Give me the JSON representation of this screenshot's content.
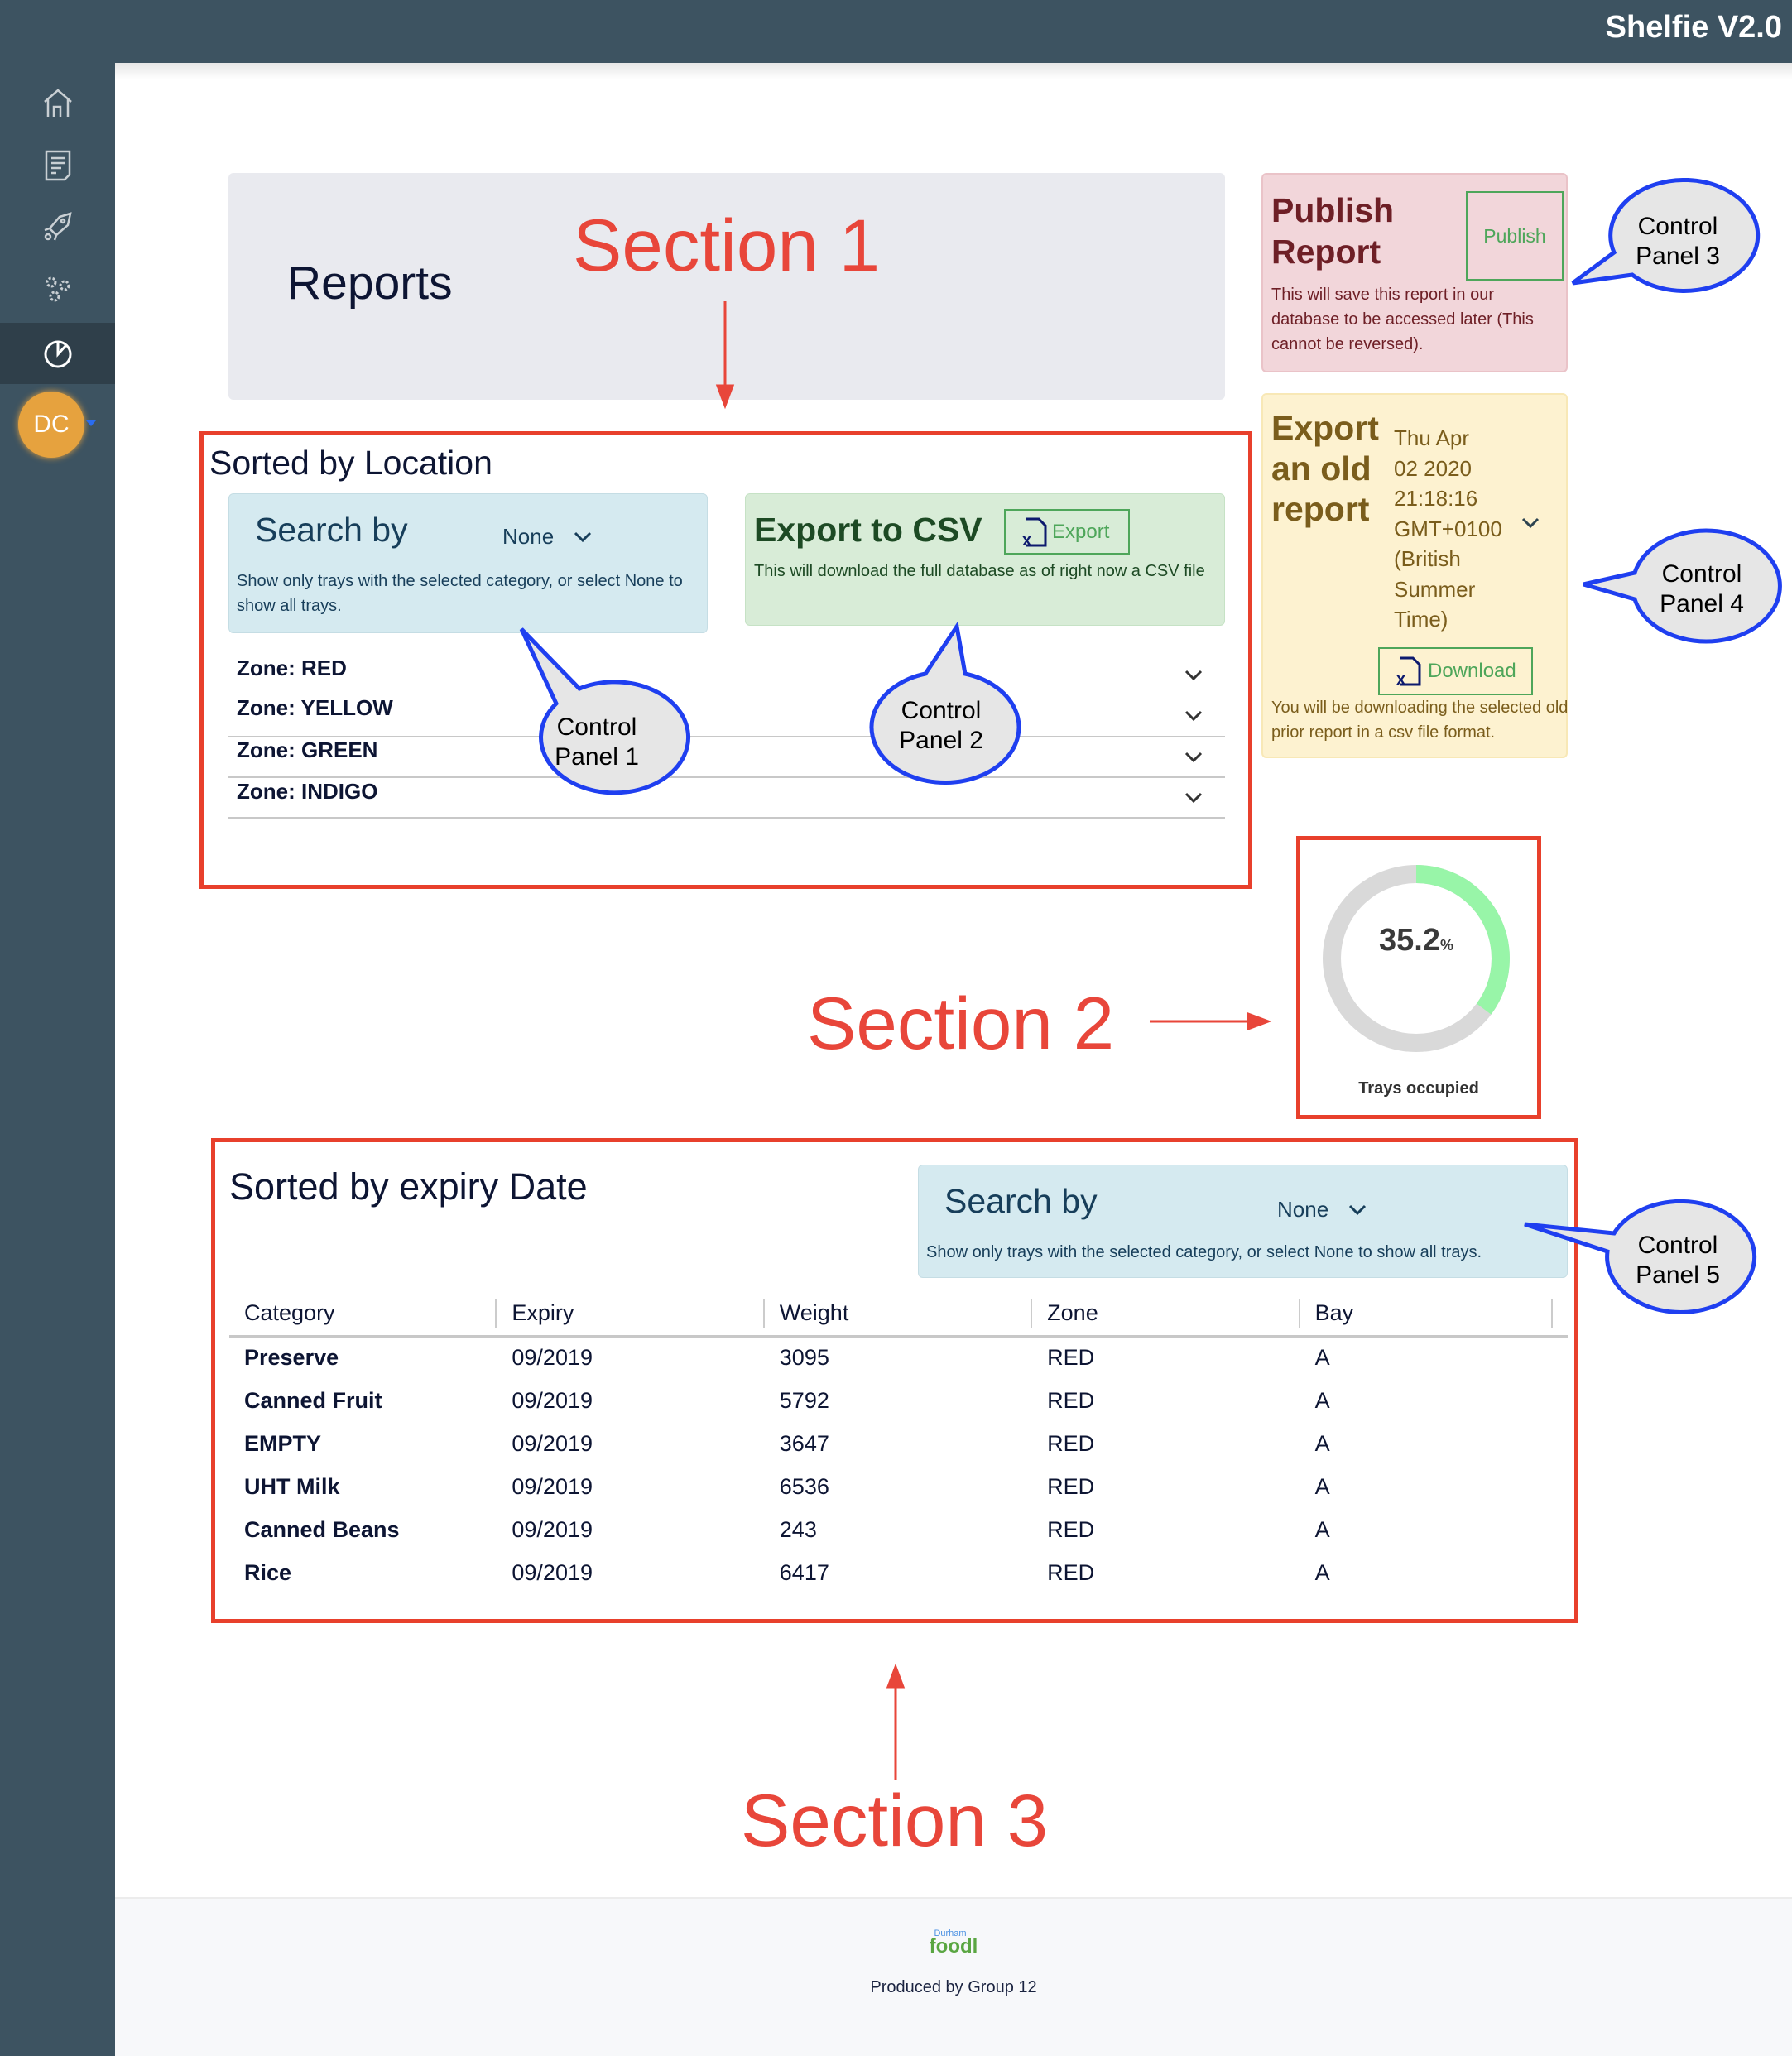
{
  "app": {
    "title": "Shelfie V2.0",
    "avatar_initials": "DC"
  },
  "sidebar": {
    "items": [
      {
        "icon": "menu-icon"
      },
      {
        "icon": "home-icon"
      },
      {
        "icon": "document-icon"
      },
      {
        "icon": "rocket-icon"
      },
      {
        "icon": "gears-icon"
      },
      {
        "icon": "pie-chart-icon",
        "active": true
      }
    ]
  },
  "header": {
    "title": "Reports"
  },
  "annotations": {
    "section1": "Section 1",
    "section2": "Section 2",
    "section3": "Section 3",
    "cp1": [
      "Control",
      "Panel 1"
    ],
    "cp2": [
      "Control",
      "Panel 2"
    ],
    "cp3": [
      "Control",
      "Panel 3"
    ],
    "cp4": [
      "Control",
      "Panel 4"
    ],
    "cp5": [
      "Control",
      "Panel 5"
    ]
  },
  "location": {
    "title": "Sorted by Location",
    "search": {
      "label": "Search by",
      "selected": "None",
      "help": "Show only trays with the selected category, or select None to show all trays."
    },
    "export": {
      "title": "Export to CSV",
      "button": "Export",
      "help": "This will download the full database as of right now a CSV file"
    },
    "zones": [
      "Zone: RED",
      "Zone: YELLOW",
      "Zone: GREEN",
      "Zone: INDIGO"
    ]
  },
  "publish": {
    "title_line1": "Publish",
    "title_line2": "Report",
    "button": "Publish",
    "help": "This will save this report in our database to be accessed later (This cannot be reversed)."
  },
  "export_old": {
    "title_lines": [
      "Export",
      "an old",
      "report"
    ],
    "selected_lines": [
      "Thu Apr",
      "02 2020",
      "21:18:16",
      "GMT+0100",
      "(British",
      "Summer",
      "Time)"
    ],
    "button": "Download",
    "help": "You will be downloading the selected old prior report in a csv file format."
  },
  "occupancy": {
    "value": "35.2",
    "unit": "%",
    "fraction": 0.352,
    "label": "Trays occupied",
    "colors": {
      "fill": "#98f5a8",
      "track": "#d9d9d9"
    }
  },
  "expiry": {
    "title": "Sorted by expiry Date",
    "search": {
      "label": "Search by",
      "selected": "None",
      "help": "Show only trays with the selected category, or select None to show all trays."
    },
    "columns": [
      "Category",
      "Expiry",
      "Weight",
      "Zone",
      "Bay"
    ],
    "rows": [
      [
        "Preserve",
        "09/2019",
        "3095",
        "RED",
        "A"
      ],
      [
        "Canned Fruit",
        "09/2019",
        "5792",
        "RED",
        "A"
      ],
      [
        "EMPTY",
        "09/2019",
        "3647",
        "RED",
        "A"
      ],
      [
        "UHT Milk",
        "09/2019",
        "6536",
        "RED",
        "A"
      ],
      [
        "Canned Beans",
        "09/2019",
        "243",
        "RED",
        "A"
      ],
      [
        "Rice",
        "09/2019",
        "6417",
        "RED",
        "A"
      ]
    ]
  },
  "footer": {
    "logo_small": "Durham",
    "logo_main": "foodl",
    "text": "Produced by Group 12"
  },
  "colors": {
    "annotation_red": "#e8463a",
    "callout_blue": "#1f3ff0",
    "sidebar": "#3d5361"
  }
}
